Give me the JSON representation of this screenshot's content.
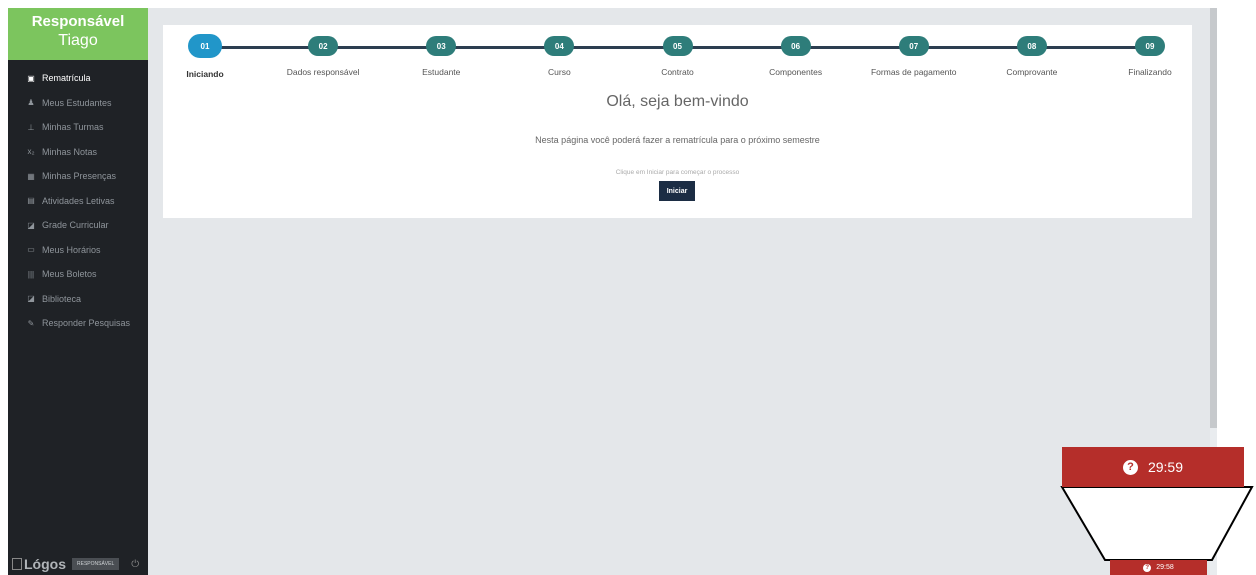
{
  "sidebar": {
    "role": "Responsável",
    "user_name": "Tiago",
    "items": [
      {
        "label": "Rematrícula",
        "icon": "file-icon",
        "glyph": "▣",
        "active": true
      },
      {
        "label": "Meus Estudantes",
        "icon": "user-icon",
        "glyph": "♟",
        "active": false
      },
      {
        "label": "Minhas Turmas",
        "icon": "pin-icon",
        "glyph": "⊥",
        "active": false
      },
      {
        "label": "Minhas Notas",
        "icon": "subscript-icon",
        "glyph": "x₂",
        "active": false
      },
      {
        "label": "Minhas Presenças",
        "icon": "table-icon",
        "glyph": "▦",
        "active": false
      },
      {
        "label": "Atividades Letivas",
        "icon": "list-icon",
        "glyph": "▤",
        "active": false
      },
      {
        "label": "Grade Curricular",
        "icon": "book-icon",
        "glyph": "◪",
        "active": false
      },
      {
        "label": "Meus Horários",
        "icon": "calendar-icon",
        "glyph": "▭",
        "active": false
      },
      {
        "label": "Meus Boletos",
        "icon": "barcode-icon",
        "glyph": "|||",
        "active": false
      },
      {
        "label": "Biblioteca",
        "icon": "book-icon",
        "glyph": "◪",
        "active": false
      },
      {
        "label": "Responder Pesquisas",
        "icon": "edit-icon",
        "glyph": "✎",
        "active": false
      }
    ],
    "footer": {
      "logo": "Lógos",
      "role_badge": "RESPONSÁVEL",
      "power_icon": "power-icon",
      "power_glyph": "⏻"
    }
  },
  "steps": [
    {
      "num": "01",
      "label": "Iniciando",
      "active": true
    },
    {
      "num": "02",
      "label": "Dados responsável",
      "active": false
    },
    {
      "num": "03",
      "label": "Estudante",
      "active": false
    },
    {
      "num": "04",
      "label": "Curso",
      "active": false
    },
    {
      "num": "05",
      "label": "Contrato",
      "active": false
    },
    {
      "num": "06",
      "label": "Componentes",
      "active": false
    },
    {
      "num": "07",
      "label": "Formas de pagamento",
      "active": false
    },
    {
      "num": "08",
      "label": "Comprovante",
      "active": false
    },
    {
      "num": "09",
      "label": "Finalizando",
      "active": false
    }
  ],
  "content": {
    "welcome": "Olá, seja bem-vindo",
    "description": "Nesta página você poderá fazer a rematrícula para o próximo semestre",
    "hint": "Clique em Iniciar para começar o processo",
    "start_button": "Iniciar"
  },
  "timer": {
    "help_icon": "help-icon",
    "help_glyph": "?",
    "zoomed_value": "29:59",
    "value": "29:58",
    "color": "#b52e2a"
  },
  "colors": {
    "sidebar_bg": "#1f2226",
    "profile_bg": "#7cc55e",
    "step_active": "#2196c9",
    "step_inactive": "#2e7d7a",
    "step_line": "#2c3e50",
    "button_bg": "#1c2d44"
  }
}
